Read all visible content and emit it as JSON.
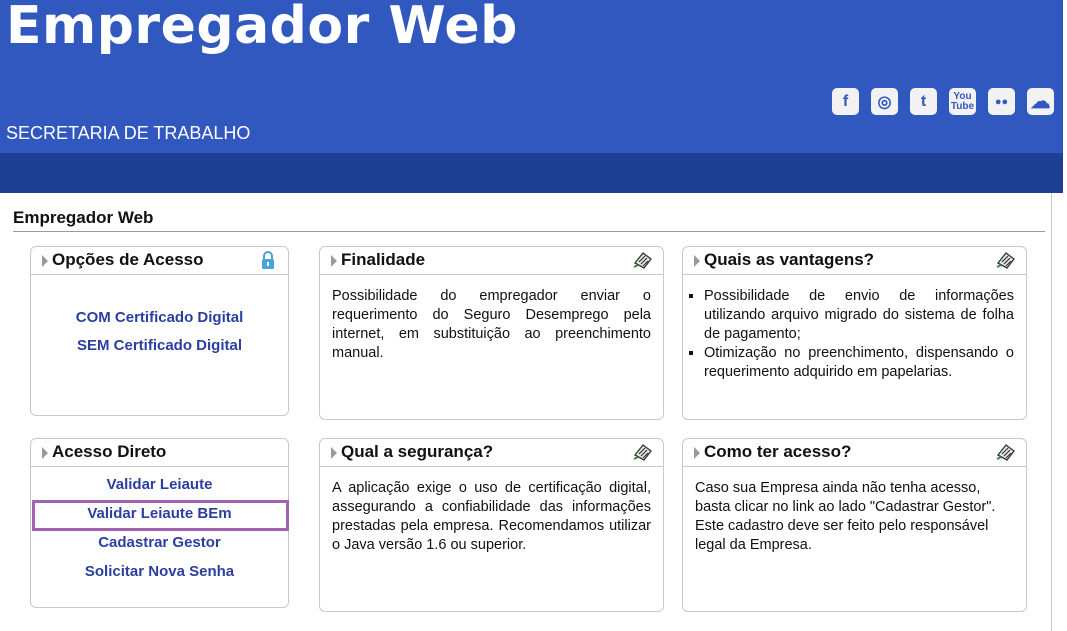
{
  "header": {
    "brand": "Empregador Web",
    "subtitle": "SECRETARIA DE TRABALHO",
    "social": [
      {
        "name": "facebook-icon",
        "glyph": "f"
      },
      {
        "name": "instagram-icon",
        "glyph": "◎"
      },
      {
        "name": "twitter-icon",
        "glyph": "t"
      },
      {
        "name": "youtube-icon",
        "glyph": "You Tube"
      },
      {
        "name": "flickr-icon",
        "glyph": "●●"
      },
      {
        "name": "soundcloud-icon",
        "glyph": "☁"
      }
    ]
  },
  "page": {
    "title": "Empregador Web"
  },
  "opcoes": {
    "title": "Opções de Acesso",
    "icon": "lock-icon",
    "links": [
      "COM Certificado Digital",
      "SEM Certificado Digital"
    ]
  },
  "finalidade": {
    "title": "Finalidade",
    "icon": "document-icon",
    "text": "Possibilidade do empregador enviar o requerimento do Seguro Desemprego pela internet, em substituição ao preenchimento manual."
  },
  "vantagens": {
    "title": "Quais as vantagens?",
    "icon": "document-icon",
    "items": [
      "Possibilidade de envio de informações utilizando arquivo migrado do sistema de folha de pagamento;",
      "Otimização no preenchimento, dispensando o requerimento adquirido em papelarias."
    ]
  },
  "acesso_direto": {
    "title": "Acesso Direto",
    "links": [
      "Validar Leiaute",
      "Validar Leiaute BEm",
      "Cadastrar Gestor",
      "Solicitar Nova Senha"
    ]
  },
  "seguranca": {
    "title": "Qual a segurança?",
    "icon": "document-icon",
    "text": "A aplicação exige o uso de certificação digital, assegurando a confiabilidade das informações prestadas pela empresa. Recomendamos utilizar o Java versão 1.6 ou superior."
  },
  "como_acesso": {
    "title": "Como ter acesso?",
    "icon": "document-icon",
    "text": "Caso sua Empresa ainda não tenha acesso, basta clicar no link ao lado \"Cadastrar Gestor\". Este cadastro deve ser feito pelo responsável legal da Empresa."
  },
  "colors": {
    "header_blue": "#3158bf",
    "nav_blue": "#1f3f93",
    "link_blue": "#2b3fa0",
    "highlight": "#a064b0"
  }
}
